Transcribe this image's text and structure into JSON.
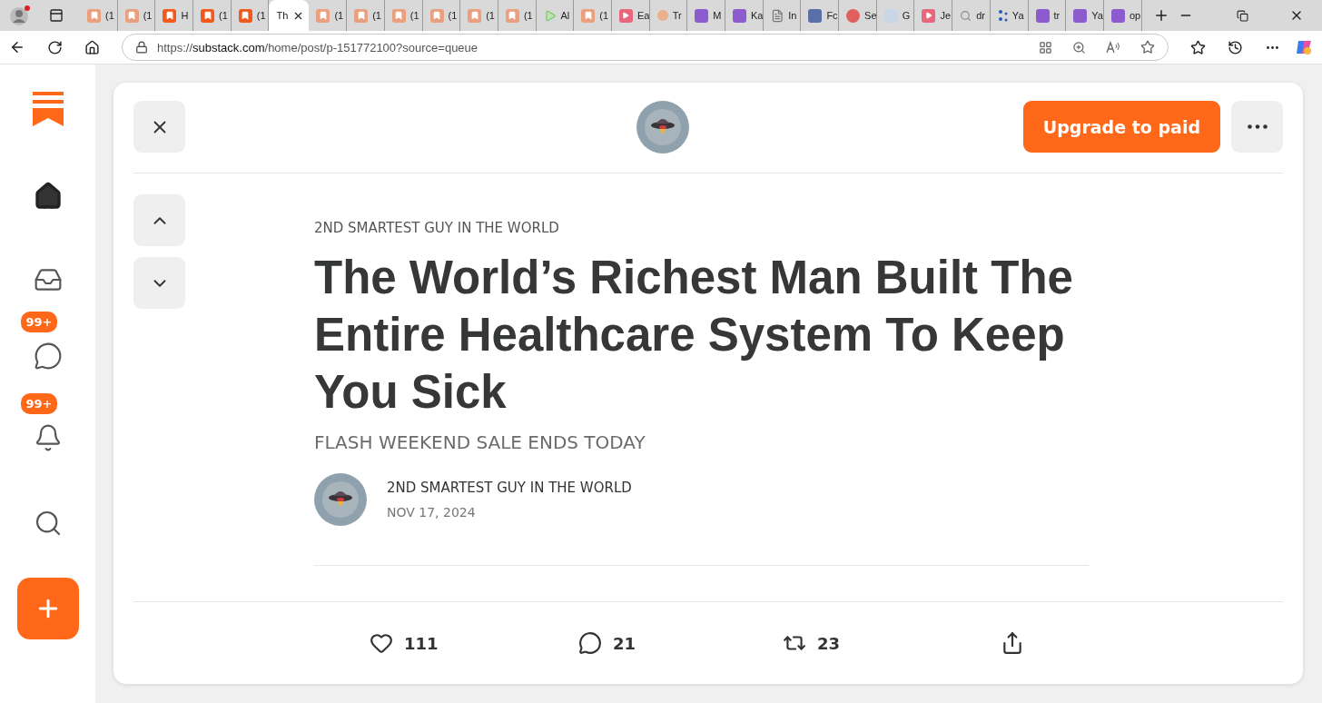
{
  "browser": {
    "tabs": [
      {
        "kind": "substack-dim",
        "label": "(1",
        "selected": false
      },
      {
        "kind": "substack-dim",
        "label": "(1",
        "selected": false
      },
      {
        "kind": "substack",
        "label": "H",
        "selected": false
      },
      {
        "kind": "substack",
        "label": "(1",
        "selected": false
      },
      {
        "kind": "substack",
        "label": "(1",
        "selected": false
      },
      {
        "label": "Th",
        "selected": true
      },
      {
        "kind": "substack-dim",
        "label": "(1",
        "selected": false
      },
      {
        "kind": "substack-dim",
        "label": "(1",
        "selected": false
      },
      {
        "kind": "substack-dim",
        "label": "(1",
        "selected": false
      },
      {
        "kind": "substack-dim",
        "label": "(1",
        "selected": false
      },
      {
        "kind": "substack-dim",
        "label": "(1",
        "selected": false
      },
      {
        "kind": "substack-dim",
        "label": "(1",
        "selected": false
      },
      {
        "kind": "play",
        "label": "Al",
        "selected": false
      },
      {
        "kind": "substack-dim",
        "label": "(1",
        "selected": false
      },
      {
        "kind": "video",
        "label": "Ea",
        "selected": false
      },
      {
        "kind": "dot",
        "label": "Tr",
        "selected": false
      },
      {
        "kind": "yahoo",
        "label": "M",
        "selected": false
      },
      {
        "kind": "yahoo",
        "label": "Ka",
        "selected": false
      },
      {
        "kind": "page",
        "label": "In",
        "selected": false
      },
      {
        "kind": "news",
        "label": "Fc",
        "selected": false
      },
      {
        "kind": "red-circle",
        "label": "Se",
        "selected": false
      },
      {
        "kind": "faded",
        "label": "G",
        "selected": false
      },
      {
        "kind": "video",
        "label": "Je",
        "selected": false
      },
      {
        "kind": "search",
        "label": "dr",
        "selected": false
      },
      {
        "kind": "dots",
        "label": "Ya",
        "selected": false
      },
      {
        "kind": "yahoo",
        "label": "tr",
        "selected": false
      },
      {
        "kind": "yahoo",
        "label": "Ya",
        "selected": false
      },
      {
        "kind": "yahoo",
        "label": "op",
        "selected": false
      }
    ],
    "url": {
      "host": "substack.com",
      "path": "/home/post/p-151772100?source=queue",
      "prefix": "https://"
    }
  },
  "sidebar": {
    "items": [
      {
        "kind": "home",
        "selected": true
      },
      {
        "kind": "inbox",
        "selected": false
      },
      {
        "kind": "chat",
        "selected": false,
        "badge": "99+"
      },
      {
        "kind": "bell",
        "selected": false,
        "badge": "99+"
      },
      {
        "kind": "search",
        "selected": false
      }
    ]
  },
  "post": {
    "upgrade_button": "Upgrade to paid",
    "publication": "2ND SMARTEST GUY IN THE WORLD",
    "title": "The World’s Richest Man Built The Entire Healthcare System To Keep You Sick",
    "subtitle": "FLASH WEEKEND SALE ENDS TODAY",
    "author": "2ND SMARTEST GUY IN THE WORLD",
    "date": "NOV 17, 2024",
    "actions": [
      {
        "kind": "like",
        "count": "111"
      },
      {
        "kind": "comment",
        "count": "21"
      },
      {
        "kind": "restack",
        "count": "23"
      },
      {
        "kind": "share"
      }
    ]
  }
}
